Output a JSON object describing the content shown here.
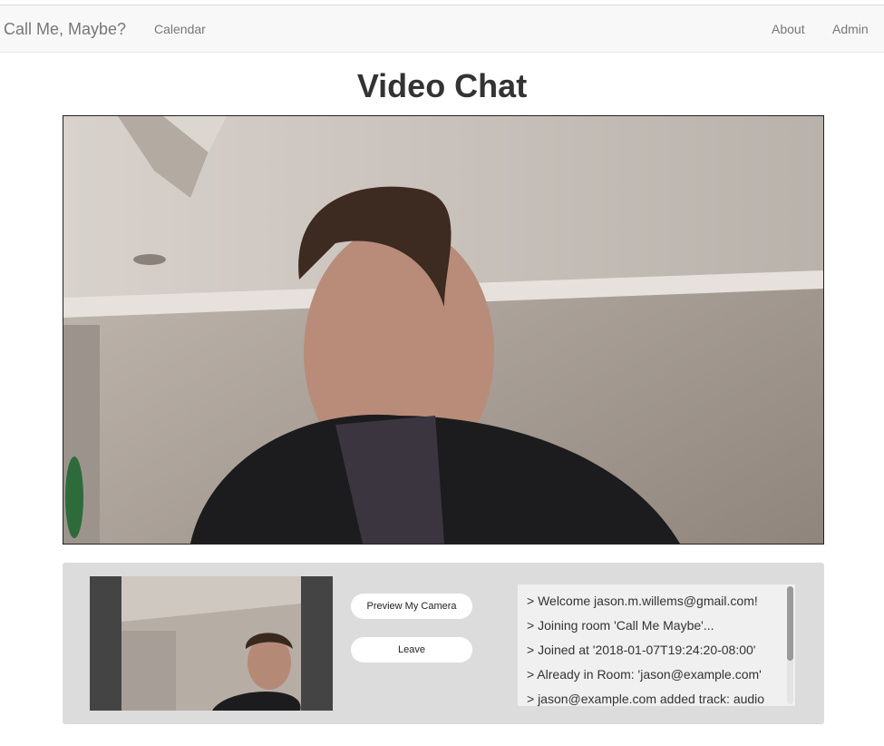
{
  "navbar": {
    "brand": "Call Me, Maybe?",
    "left_links": [
      "Calendar"
    ],
    "right_links": [
      "About",
      "Admin"
    ]
  },
  "page": {
    "title": "Video Chat"
  },
  "controls": {
    "preview_label": "Preview My Camera",
    "leave_label": "Leave"
  },
  "log": {
    "lines": [
      "> Welcome jason.m.willems@gmail.com!",
      "> Joining room 'Call Me Maybe'...",
      "> Joined at '2018-01-07T19:24:20-08:00'",
      "> Already in Room: 'jason@example.com'",
      "> jason@example.com added track: audio"
    ]
  },
  "colors": {
    "navbar_bg": "#f8f8f8",
    "panel_bg": "#dcdcdc",
    "log_bg": "#f0f0f0"
  }
}
